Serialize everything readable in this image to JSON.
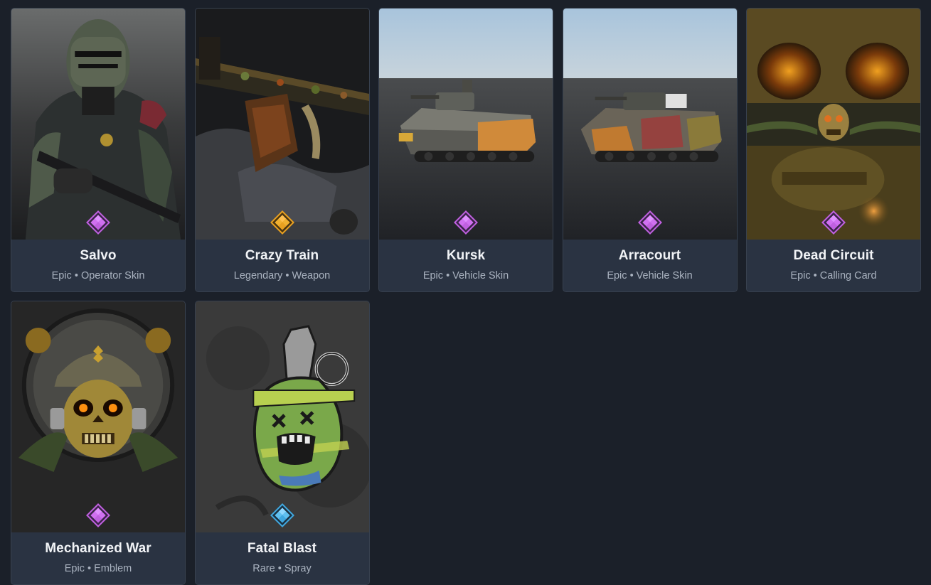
{
  "items": [
    {
      "name": "Salvo",
      "rarity": "Epic",
      "category": "Operator Skin",
      "rarity_color": "#c060e0",
      "art": "operator-soldier"
    },
    {
      "name": "Crazy Train",
      "rarity": "Legendary",
      "category": "Weapon",
      "rarity_color": "#e8a020",
      "art": "camo-machine-gun"
    },
    {
      "name": "Kursk",
      "rarity": "Epic",
      "category": "Vehicle Skin",
      "rarity_color": "#c060e0",
      "art": "orange-ifv"
    },
    {
      "name": "Arracourt",
      "rarity": "Epic",
      "category": "Vehicle Skin",
      "rarity_color": "#c060e0",
      "art": "camo-ifv"
    },
    {
      "name": "Dead Circuit",
      "rarity": "Epic",
      "category": "Calling Card",
      "rarity_color": "#c060e0",
      "art": "skull-banner"
    },
    {
      "name": "Mechanized War",
      "rarity": "Epic",
      "category": "Emblem",
      "rarity_color": "#c060e0",
      "art": "helmet-skull-emblem"
    },
    {
      "name": "Fatal Blast",
      "rarity": "Rare",
      "category": "Spray",
      "rarity_color": "#40a8e0",
      "art": "grenade-face"
    }
  ],
  "separator": "•"
}
